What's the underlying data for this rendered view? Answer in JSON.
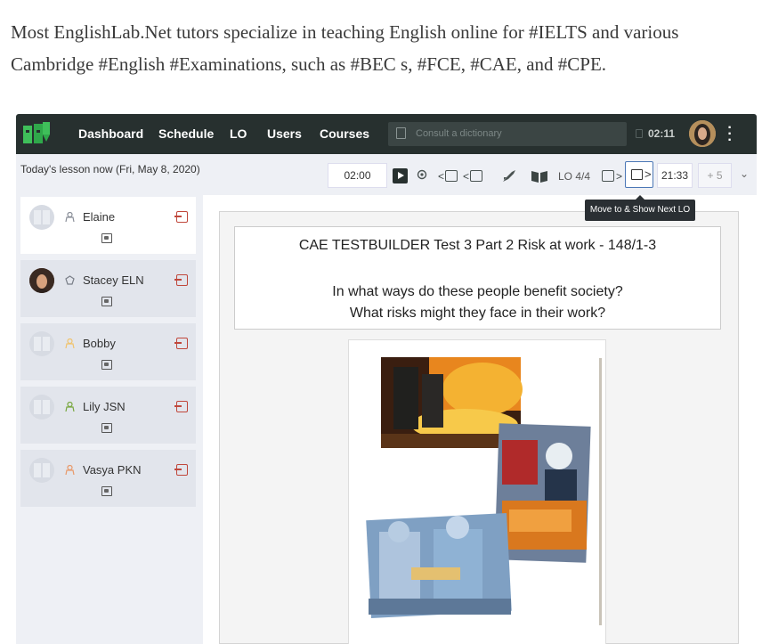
{
  "intro_text": "Most EnglishLab.Net tutors specialize in teaching English online for #IELTS and various Cambridge #English #Examinations, such as #BEC s, #FCE, #CAE, and #CPE.",
  "topnav": {
    "items": [
      "Dashboard",
      "Schedule",
      "LO",
      "Users",
      "Courses"
    ],
    "dictionary_placeholder": "Consult a dictionary",
    "time": "02:11"
  },
  "toolbar": {
    "lesson_label": "Today's lesson now (Fri, May 8, 2020)",
    "timer": "02:00",
    "lo_counter": "LO 4/4",
    "clock": "21:33",
    "plus": "+ 5",
    "tooltip": "Move to & Show Next LO"
  },
  "participants": [
    {
      "name": "Elaine",
      "role_color": "#8a8f99",
      "avatar": "ghost",
      "active": true
    },
    {
      "name": "Stacey ELN",
      "role_color": "#7a7f88",
      "avatar": "photo",
      "active": false
    },
    {
      "name": "Bobby",
      "role_color": "#f0c36e",
      "avatar": "ghost",
      "active": false
    },
    {
      "name": "Lily JSN",
      "role_color": "#78a73f",
      "avatar": "ghost",
      "active": false
    },
    {
      "name": "Vasya PKN",
      "role_color": "#e89a6b",
      "avatar": "ghost",
      "active": false
    }
  ],
  "slide": {
    "title": "CAE TESTBUILDER Test 3 Part 2 Risk at work - 148/1-3",
    "question_1": "In what ways do these people benefit society?",
    "question_2": "What risks might they face in their work?"
  },
  "colors": {
    "nav_bg": "#27302f",
    "brand_green": "#3fbf5a",
    "exit_red": "#c0473b",
    "active_border": "#4b77b6"
  }
}
